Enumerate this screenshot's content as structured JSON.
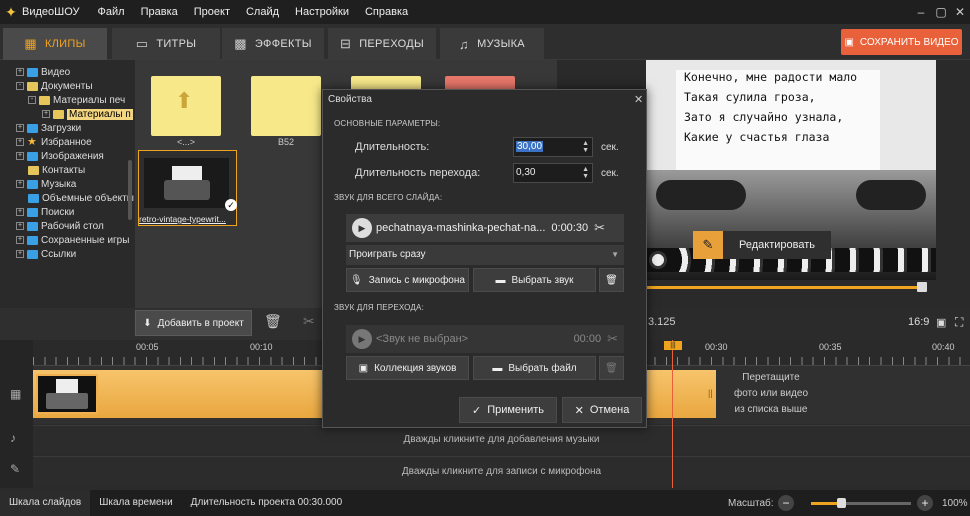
{
  "titlebar": {
    "app_name": "ВидеоШОУ",
    "menu": [
      "Файл",
      "Правка",
      "Проект",
      "Слайд",
      "Настройки",
      "Справка"
    ]
  },
  "tabs": [
    {
      "label": "КЛИПЫ",
      "icon": "film-icon"
    },
    {
      "label": "ТИТРЫ",
      "icon": "speech-bubble-icon"
    },
    {
      "label": "ЭФФЕКТЫ",
      "icon": "grid-icon"
    },
    {
      "label": "ПЕРЕХОДЫ",
      "icon": "transition-icon"
    },
    {
      "label": "МУЗЫКА",
      "icon": "music-note-icon"
    }
  ],
  "save_button": "СОХРАНИТЬ ВИДЕО",
  "tree": [
    {
      "label": "Видео"
    },
    {
      "label": "Документы"
    },
    {
      "label": "Материалы печ"
    },
    {
      "label": "Материалы п"
    },
    {
      "label": "Загрузки"
    },
    {
      "label": "Избранное"
    },
    {
      "label": "Изображения"
    },
    {
      "label": "Контакты"
    },
    {
      "label": "Музыка"
    },
    {
      "label": "Объемные объекты"
    },
    {
      "label": "Поиски"
    },
    {
      "label": "Рабочий стол"
    },
    {
      "label": "Сохраненные игры"
    },
    {
      "label": "Ссылки"
    }
  ],
  "files": {
    "up_label": "<...>",
    "folder_label": "B52",
    "thumb_label": "retro-vintage-typewrit..."
  },
  "toolbar": {
    "add_label": "Добавить в проект"
  },
  "preview": {
    "poem": [
      "Конечно, мне радости мало",
      "Такая сулила гроза,",
      "Зато я случайно узнала,",
      "Какие у счастья глаза"
    ],
    "edit_label": "Редактировать",
    "timecode": "3.125",
    "ratio": "16:9",
    "progress": 0.95
  },
  "ruler": [
    "00:05",
    "00:10",
    "00:30",
    "00:35",
    "00:40"
  ],
  "timeline": {
    "drop_hint": [
      "Перетащите",
      "фото или видео",
      "из списка выше"
    ],
    "music_hint": "Дважды кликните для добавления музыки",
    "mic_hint": "Дважды кликните для записи с микрофона"
  },
  "statusbar": {
    "slides_tab": "Шкала слайдов",
    "time_tab": "Шкала времени",
    "duration": "Длительность проекта 00:30.000",
    "zoom_label": "Масштаб:",
    "zoom_value": "100%",
    "zoom_fraction": 0.3
  },
  "dialog": {
    "title": "Свойства",
    "section_main": "ОСНОВНЫЕ ПАРАМЕТРЫ:",
    "duration_label": "Длительность:",
    "duration_value": "30,00",
    "transition_label": "Длительность перехода:",
    "transition_value": "0,30",
    "unit": "сек.",
    "section_slide_sound": "ЗВУК ДЛЯ ВСЕГО СЛАЙДА:",
    "sound_name": "pechatnaya-mashinka-pechat-na...",
    "sound_time": "0:00:30",
    "play_mode": "Проиграть сразу",
    "mic_button": "Запись с микрофона",
    "choose_sound_button": "Выбрать звук",
    "section_transition_sound": "ЗВУК ДЛЯ ПЕРЕХОДА:",
    "no_sound": "<Звук не выбран>",
    "no_sound_time": "00:00",
    "collection_button": "Коллекция звуков",
    "choose_file_button": "Выбрать файл",
    "apply_button": "Применить",
    "cancel_button": "Отмена"
  }
}
